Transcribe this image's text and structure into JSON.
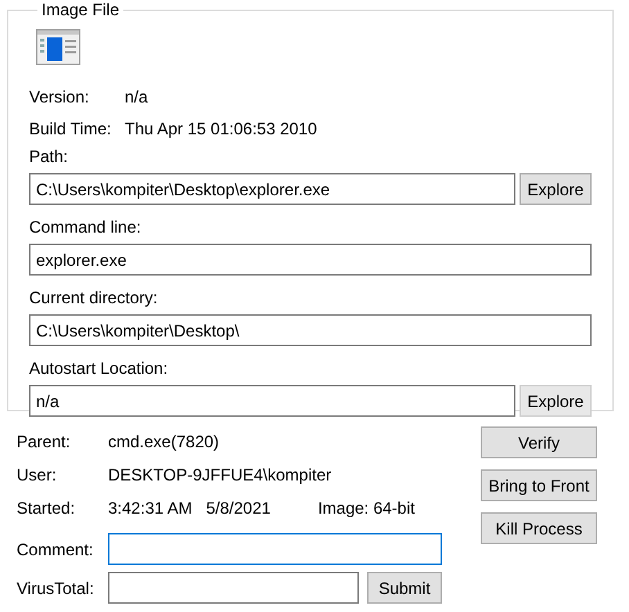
{
  "group": {
    "title": "Image File"
  },
  "info": [
    {
      "label": "Version:",
      "value": "n/a"
    },
    {
      "label": "Build Time:",
      "value": "Thu Apr 15 01:06:53 2010"
    }
  ],
  "fields": [
    {
      "label": "Path:",
      "value": "C:\\Users\\kompiter\\Desktop\\explorer.exe",
      "button": {
        "label": "Explore",
        "disabled": false
      }
    },
    {
      "label": "Command line:",
      "value": "explorer.exe"
    },
    {
      "label": "Current directory:",
      "value": "C:\\Users\\kompiter\\Desktop\\"
    },
    {
      "label": "Autostart Location:",
      "value": "n/a",
      "button": {
        "label": "Explore",
        "disabled": true
      }
    }
  ],
  "process": [
    {
      "label": "Parent:",
      "values": [
        "cmd.exe(7820)"
      ]
    },
    {
      "label": "User:",
      "values": [
        "DESKTOP-9JFFUE4\\kompiter"
      ]
    },
    {
      "label": "Started:",
      "values": [
        "3:42:31 AM",
        "5/8/2021",
        "Image: 64-bit"
      ]
    }
  ],
  "comment": {
    "label": "Comment:",
    "focused": true
  },
  "virustotal": {
    "label": "VirusTotal:",
    "button": "Submit"
  },
  "actions": [
    "Verify",
    "Bring to Front",
    "Kill Process"
  ]
}
